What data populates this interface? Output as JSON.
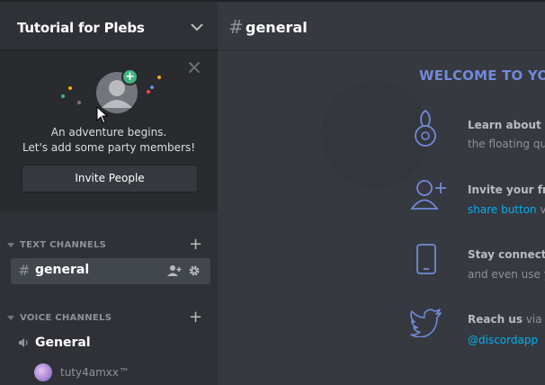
{
  "server": {
    "name": "Tutorial for Plebs",
    "menu_icon": "chevron-down-icon"
  },
  "invite_card": {
    "line1": "An adventure begins.",
    "line2": "Let's add some party members!",
    "button_label": "Invite People",
    "close_icon": "close-icon"
  },
  "text_channels": {
    "category_label": "TEXT CHANNELS",
    "channels": [
      {
        "name": "general",
        "prefix": "#"
      }
    ]
  },
  "voice_channels": {
    "category_label": "VOICE CHANNELS",
    "channels": [
      {
        "name": "General",
        "users": [
          {
            "name": "tuty4amxx™"
          }
        ]
      }
    ]
  },
  "main": {
    "channel_prefix": "#",
    "channel_name": "general",
    "welcome_title": "WELCOME TO YO",
    "features": [
      {
        "icon": "compass-icon",
        "title": "Learn about D",
        "desc": "the floating qu"
      },
      {
        "icon": "add-friend-icon",
        "title": "Invite your fri",
        "desc_link": "share button",
        "desc_suffix": " v"
      },
      {
        "icon": "mobile-phone-icon",
        "title": "Stay connecte",
        "desc": "and even use y"
      },
      {
        "icon": "twitter-bird-icon",
        "title_prefix": "Reach us",
        "title_suffix": " via ",
        "title_link": "@",
        "desc_link": "@discordapp"
      }
    ]
  },
  "colors": {
    "sidebar_bg": "#2f3136",
    "card_bg": "#292b2f",
    "main_bg": "#36393f",
    "accent": "#7289da",
    "link": "#00b0f4",
    "online_green": "#43b581"
  }
}
